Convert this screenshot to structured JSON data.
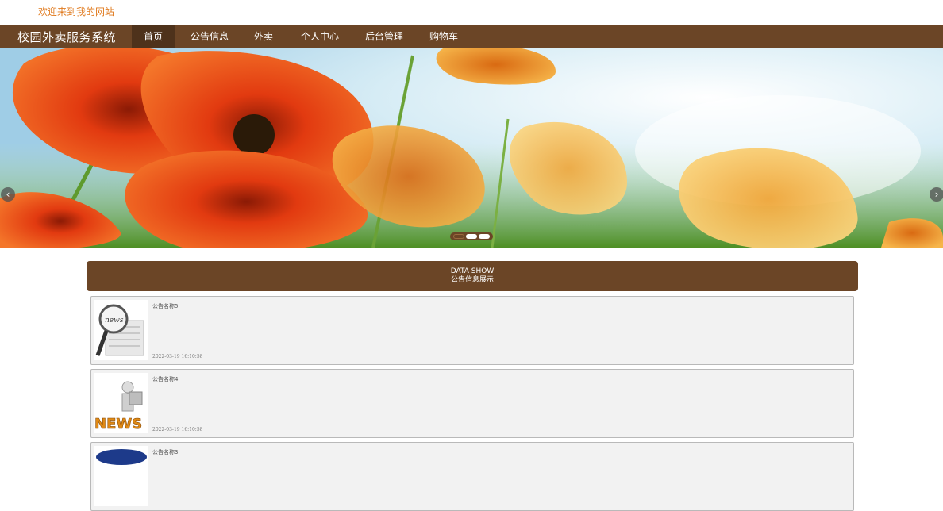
{
  "header": {
    "welcome": "欢迎来到我的网站"
  },
  "nav": {
    "brand": "校园外卖服务系统",
    "items": [
      {
        "label": "首页",
        "active": true
      },
      {
        "label": "公告信息"
      },
      {
        "label": "外卖"
      },
      {
        "label": "个人中心"
      },
      {
        "label": "后台管理"
      },
      {
        "label": "购物车"
      }
    ]
  },
  "banner": {
    "prev_icon": "chevron-left-icon",
    "next_icon": "chevron-right-icon",
    "prev_glyph": "‹",
    "next_glyph": "›",
    "slide_count": 3,
    "active_slide": 1
  },
  "section": {
    "title_en": "DATA SHOW",
    "title_cn": "公告信息展示"
  },
  "notices": [
    {
      "title": "公告名称5",
      "date": "2022-03-19 16:10:58",
      "icon": "news-magnifier-icon"
    },
    {
      "title": "公告名称4",
      "date": "2022-03-19 16:10:58",
      "icon": "news-3d-figure-icon"
    },
    {
      "title": "公告名称3",
      "date": "",
      "icon": "news-badge-icon"
    }
  ],
  "colors": {
    "brand_brown": "#6b4526",
    "active_nav": "#4e321b",
    "welcome_orange": "#e07a1e"
  }
}
